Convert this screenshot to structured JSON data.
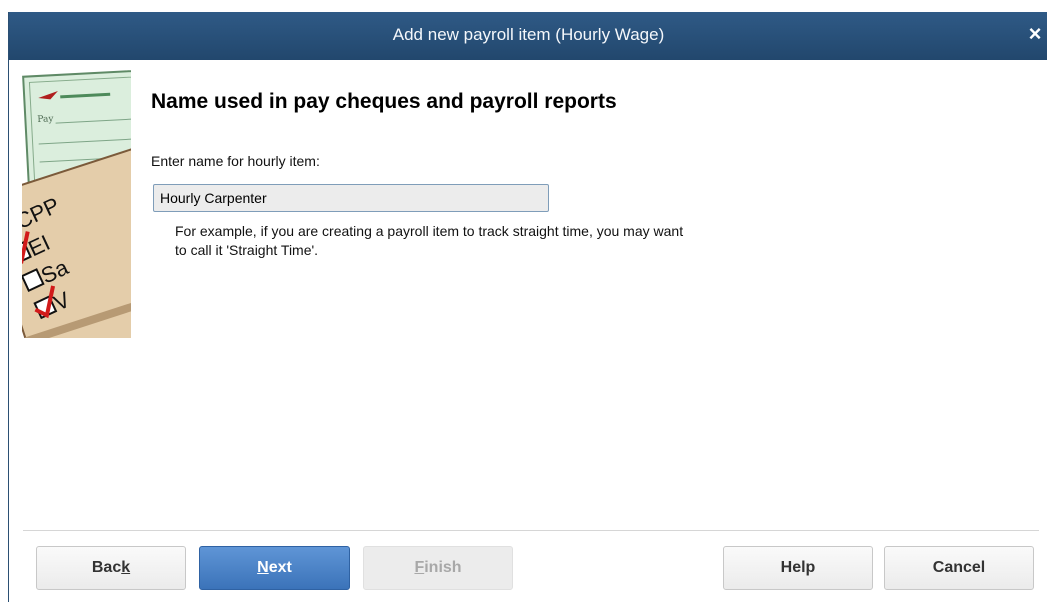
{
  "window": {
    "title": "Add new payroll item (Hourly Wage)",
    "close_glyph": "×"
  },
  "main": {
    "heading": "Name used in pay cheques and payroll reports",
    "field_label": "Enter name for hourly item:",
    "field_value": "Hourly Carpenter",
    "example_line1": "For example, if you are creating a payroll item to track straight time, you may want",
    "example_line2": "to call it 'Straight Time'."
  },
  "graphic": {
    "pay_label": "Pay",
    "check_labels": [
      "CPP",
      "EI",
      "Sa",
      "V"
    ],
    "checked": [
      true,
      true,
      false,
      true
    ]
  },
  "buttons": {
    "back": {
      "pre": "Bac",
      "mnemonic": "k",
      "post": ""
    },
    "next": {
      "pre": "",
      "mnemonic": "N",
      "post": "ext"
    },
    "finish": {
      "pre": "",
      "mnemonic": "F",
      "post": "inish"
    },
    "help": "Help",
    "cancel": "Cancel"
  },
  "colors": {
    "titlebar": "#2f5a86",
    "primary_button": "#4a84c8",
    "check_red": "#d11a1a",
    "form_tan": "#dfc7a4"
  }
}
